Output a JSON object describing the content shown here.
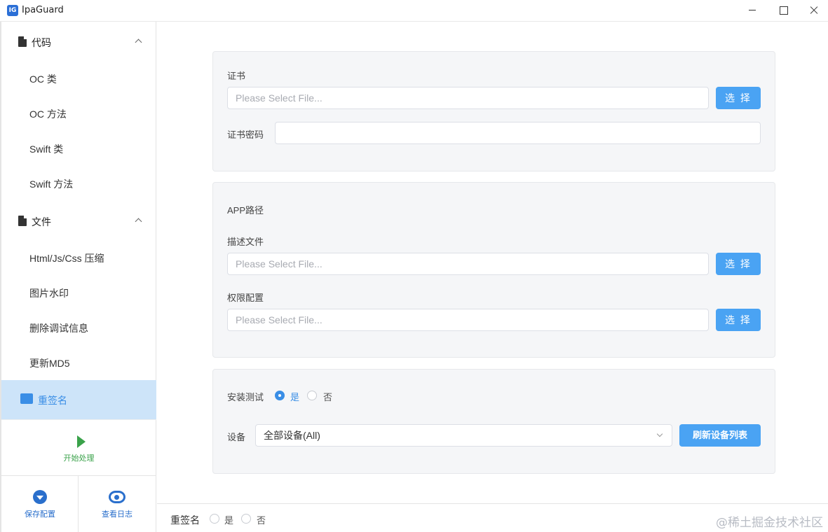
{
  "window": {
    "title": "IpaGuard",
    "icon_text": "IG"
  },
  "sidebar": {
    "groups": [
      {
        "label": "代码",
        "items": [
          "OC 类",
          "OC 方法",
          "Swift 类",
          "Swift 方法"
        ]
      },
      {
        "label": "文件",
        "items": [
          "Html/Js/Css 压缩",
          "图片水印",
          "删除调试信息",
          "更新MD5"
        ]
      }
    ],
    "active_item": "重签名",
    "start_label": "开始处理",
    "save_label": "保存配置",
    "log_label": "查看日志"
  },
  "cert": {
    "label": "证书",
    "placeholder": "Please Select File...",
    "button": "选 择",
    "password_label": "证书密码",
    "password_value": ""
  },
  "app": {
    "section_label": "APP路径",
    "profile_label": "描述文件",
    "profile_placeholder": "Please Select File...",
    "profile_button": "选 择",
    "entitlements_label": "权限配置",
    "entitlements_placeholder": "Please Select File...",
    "entitlements_button": "选 择"
  },
  "install": {
    "label": "安装测试",
    "yes": "是",
    "no": "否",
    "selected": "yes",
    "device_label": "设备",
    "device_value": "全部设备(All)",
    "refresh_button": "刷新设备列表"
  },
  "footer": {
    "resign_label": "重签名",
    "yes": "是",
    "no": "否",
    "watermark": "@稀土掘金技术社区"
  },
  "colors": {
    "accent": "#4aa3f3",
    "active_bg": "#cde4f9",
    "start_green": "#3aa24a",
    "bottom_blue": "#2a6fcc"
  }
}
